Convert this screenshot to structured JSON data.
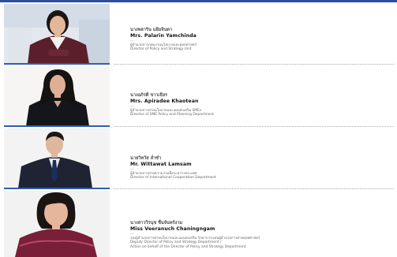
{
  "people": [
    {
      "thai_name": "นางพลาริน แย้มจินดา",
      "eng_name": "Mrs. Palarin Yamchinda",
      "lines": [
        "ผู้อำนวยการกลุ่มงานนโยบายและยุทธศาสตร์",
        "Director of Policy and Strategy Unit"
      ]
    },
    {
      "thai_name": "นางอภิรดี ขาวเธียร",
      "eng_name": "Mrs. Apiradee Khaotean",
      "lines": [
        "ผู้อำนวยการฝ่ายนโยบายและแผนส่งเสริม SMEs",
        "Director of SME Policy and Planning Department"
      ]
    },
    {
      "thai_name": "นายวิทวัส ล่ำซำ",
      "eng_name": "Mr. Wittawat Lamsam",
      "lines": [
        "ผู้อำนวยการฝ่ายความร่วมมือระหว่างประเทศ",
        "Director of International Cooperation Department"
      ]
    },
    {
      "thai_name": "นางสาววีรนุช ชื่นจันทร์งาม",
      "eng_name": "Miss Veeranuch Chaningngam",
      "lines": [
        "รองผู้อำนวยการฝ่ายนโยบายและแผนส่งเสริม รักษาการแทนผู้อำนวยการฝ่ายยุทธศาสตร์",
        "Deputy Director of Policy and Strategy Department /",
        "Action on behalf of the Director of Policy and Strategy Department"
      ]
    }
  ],
  "separator": "---",
  "colors": {
    "accent": "#2e5db3",
    "topbar": "#2d4f9e"
  }
}
